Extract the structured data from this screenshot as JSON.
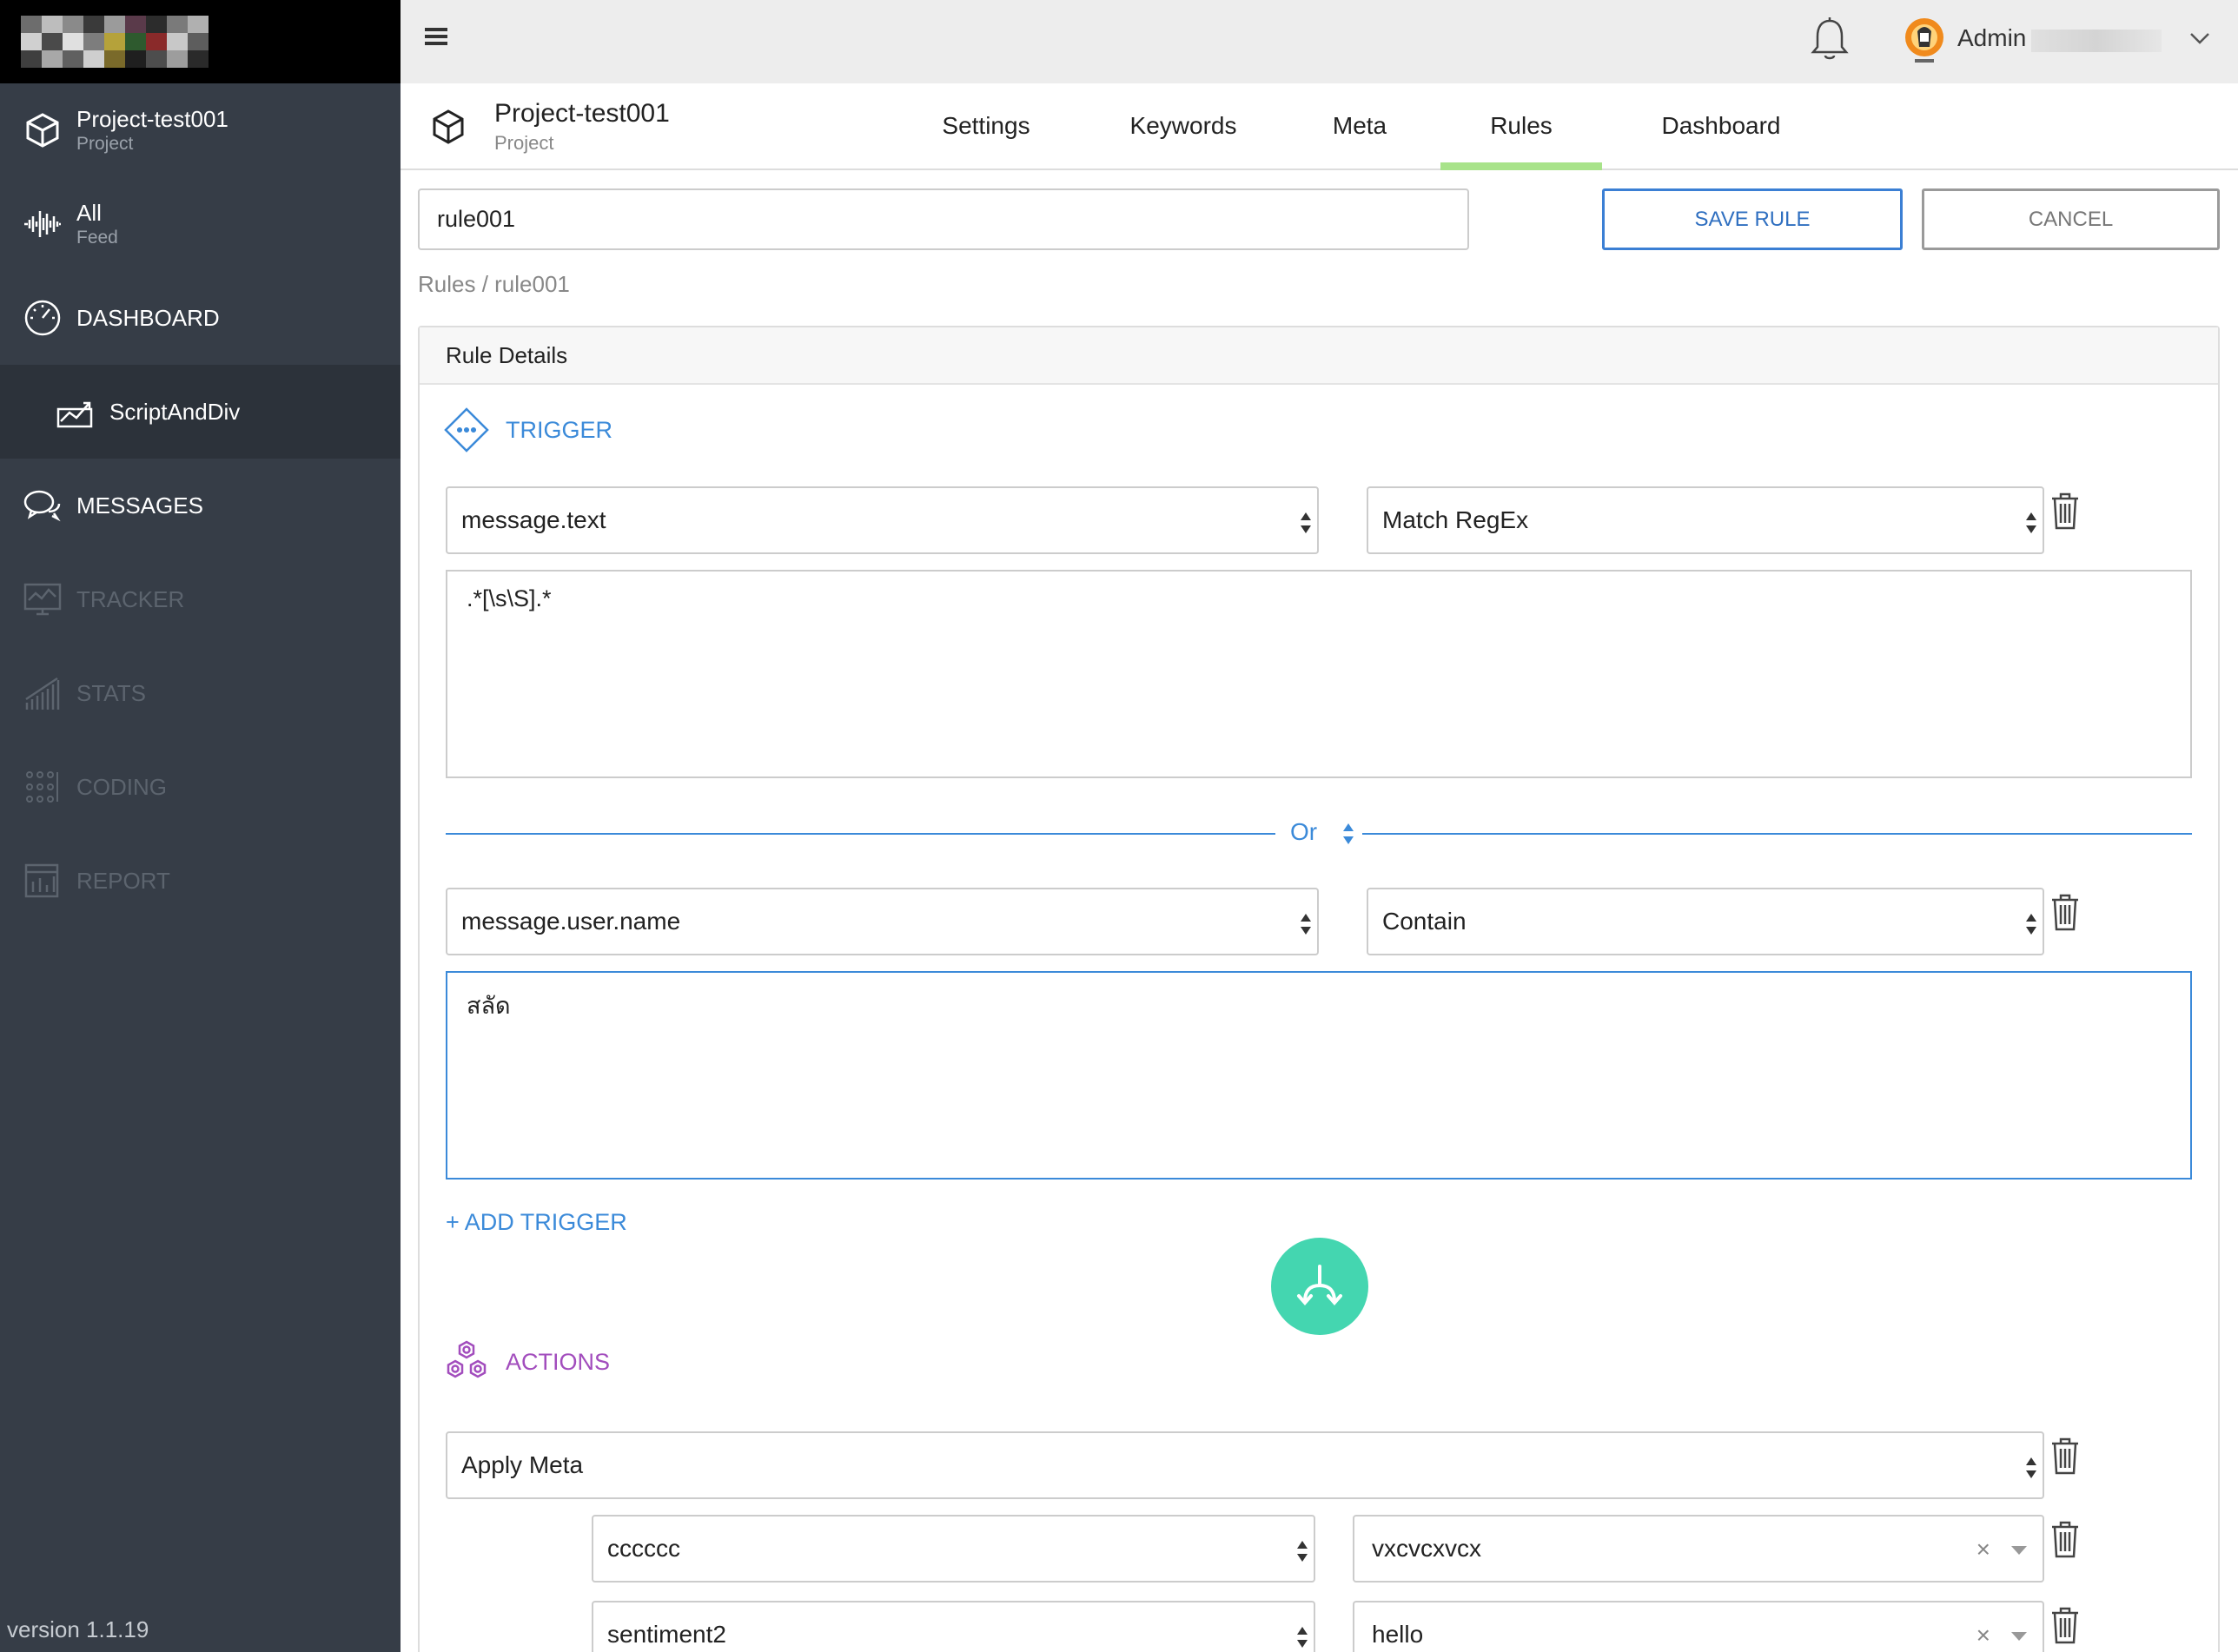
{
  "sidebar": {
    "project": {
      "label": "Project-test001",
      "sub": "Project"
    },
    "feed": {
      "label": "All",
      "sub": "Feed"
    },
    "dashboard": {
      "label": "DASHBOARD"
    },
    "script_and_div": {
      "label": "ScriptAndDiv"
    },
    "messages": {
      "label": "MESSAGES"
    },
    "tracker": {
      "label": "TRACKER"
    },
    "stats": {
      "label": "STATS"
    },
    "coding": {
      "label": "CODING"
    },
    "report": {
      "label": "REPORT"
    },
    "version": "version 1.1.19"
  },
  "topbar": {
    "user_name": "Admin"
  },
  "project_header": {
    "title": "Project-test001",
    "subtitle": "Project",
    "tabs": [
      {
        "label": "Settings"
      },
      {
        "label": "Keywords"
      },
      {
        "label": "Meta"
      },
      {
        "label": "Rules",
        "active": true
      },
      {
        "label": "Dashboard"
      }
    ]
  },
  "rule": {
    "name": "rule001",
    "save_label": "SAVE RULE",
    "cancel_label": "CANCEL",
    "breadcrumb": "Rules / rule001"
  },
  "panel": {
    "title": "Rule Details",
    "trigger_label": "TRIGGER",
    "triggers": [
      {
        "field": "message.text",
        "operator": "Match RegEx",
        "value": ".*[\\s\\S].*"
      },
      {
        "field": "message.user.name",
        "operator": "Contain",
        "value": "สลัด"
      }
    ],
    "or_label": "Or",
    "add_trigger_label": "+ ADD TRIGGER",
    "actions_label": "ACTIONS",
    "action": {
      "type": "Apply Meta",
      "rows": [
        {
          "key": "cccccc",
          "value": "vxcvcxvcx"
        },
        {
          "key": "sentiment2",
          "value": "hello"
        }
      ]
    }
  },
  "colors": {
    "sidebar_bg": "#363d47",
    "accent_blue": "#3b8ad9",
    "tab_active": "#a8e38a",
    "actions_purple": "#a24dbd",
    "flow_green": "#44d6b0"
  }
}
